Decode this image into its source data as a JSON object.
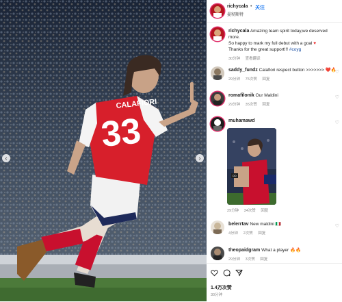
{
  "post": {
    "username": "richycala",
    "location": "曼彻斯特",
    "follow_label": "关注"
  },
  "caption": {
    "username": "richycala",
    "text_line1": "Amazing team spirit today,we deserved more.",
    "text_line2": "So happy to mark my full debut with a goal",
    "text_line3": "Thanks for the great support!!!",
    "hashtag": "#coyg",
    "time": "30分钟",
    "action": "查看翻译"
  },
  "comments": [
    {
      "username": "saddy_fundz",
      "text": "Calafiori respect button >>>>>>>",
      "emoji": "❤️🔥",
      "time": "29分钟",
      "likes": "75次赞",
      "reply": "回复"
    },
    {
      "username": "romafilonik",
      "text": "Our Maldini",
      "time": "29分钟",
      "likes": "35次赞",
      "reply": "回复"
    },
    {
      "username": "muhamawd",
      "text": "",
      "time": "29分钟",
      "likes": "34次赞",
      "reply": "回复",
      "has_image": true
    },
    {
      "username": "belerrtav",
      "text": "New maldini 🇮🇹",
      "time": "4分钟",
      "likes": "2次赞",
      "reply": "回复"
    },
    {
      "username": "theopaidgram",
      "text": "What a player",
      "emoji": "🔥🔥",
      "time": "29分钟",
      "likes": "3次赞",
      "reply": "回复"
    }
  ],
  "footer": {
    "likes_count": "1.4万次赞",
    "time_ago": "30分钟",
    "icons": [
      "heart-icon",
      "comment-icon",
      "share-icon"
    ]
  },
  "photo": {
    "jersey_name": "CALAFIORI",
    "jersey_number": "33",
    "kit_color": "#d71f2b",
    "sleeve_color": "#ffffff"
  },
  "inset": {
    "chip_text": "DD"
  }
}
